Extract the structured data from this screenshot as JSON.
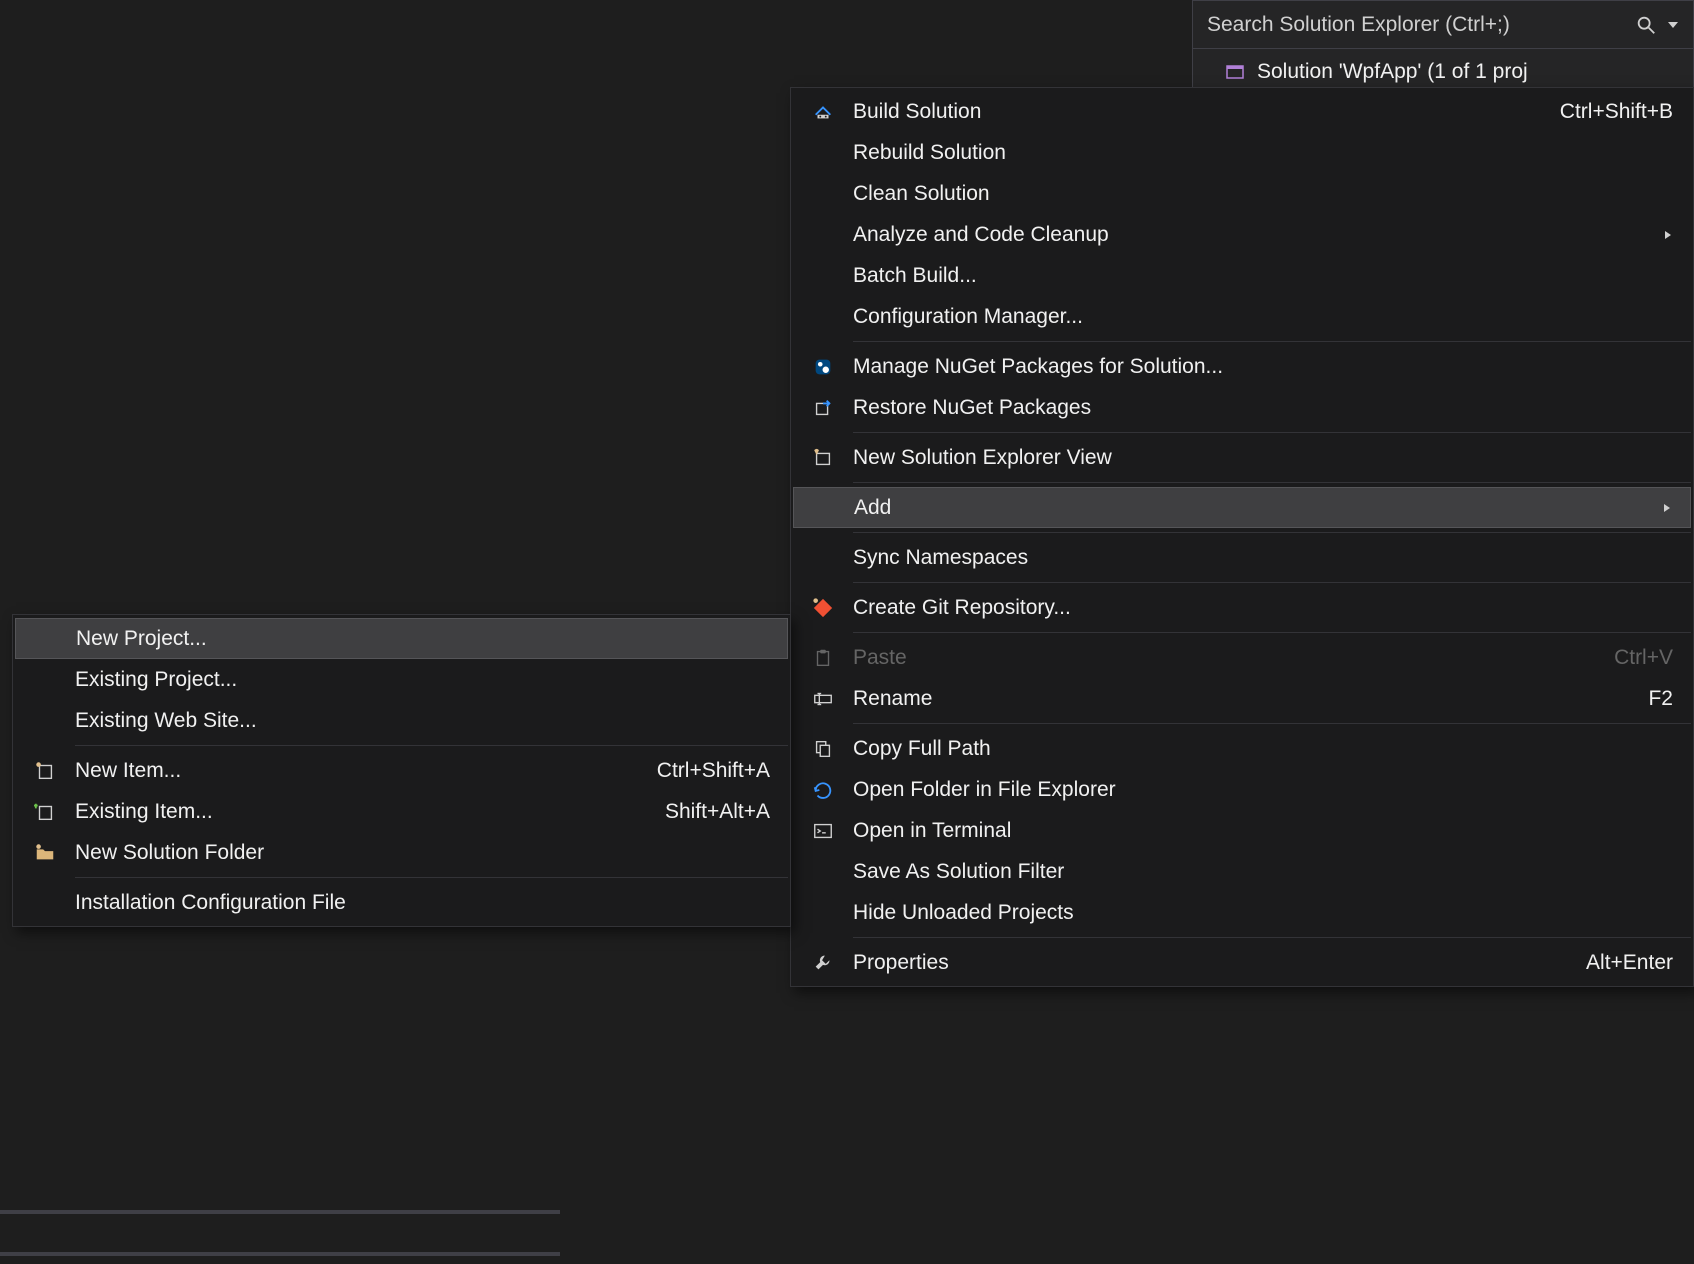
{
  "solutionExplorer": {
    "searchPlaceholder": "Search Solution Explorer (Ctrl+;)",
    "solutionLabel": "Solution 'WpfApp' (1 of 1 proj"
  },
  "mainMenu": {
    "items": [
      {
        "id": "build",
        "label": "Build Solution",
        "shortcut": "Ctrl+Shift+B",
        "icon": "build-icon"
      },
      {
        "id": "rebuild",
        "label": "Rebuild Solution"
      },
      {
        "id": "clean",
        "label": "Clean Solution"
      },
      {
        "id": "analyze",
        "label": "Analyze and Code Cleanup",
        "submenu": true
      },
      {
        "id": "batch",
        "label": "Batch Build..."
      },
      {
        "id": "cfg",
        "label": "Configuration Manager..."
      },
      {
        "sep": true
      },
      {
        "id": "nuget",
        "label": "Manage NuGet Packages for Solution...",
        "icon": "nuget-icon"
      },
      {
        "id": "restore",
        "label": "Restore NuGet Packages",
        "icon": "restore-icon"
      },
      {
        "sep": true
      },
      {
        "id": "newview",
        "label": "New Solution Explorer View",
        "icon": "newview-icon"
      },
      {
        "sep": true
      },
      {
        "id": "add",
        "label": "Add",
        "submenu": true,
        "highlight": true
      },
      {
        "sep": true
      },
      {
        "id": "sync",
        "label": "Sync Namespaces"
      },
      {
        "sep": true
      },
      {
        "id": "git",
        "label": "Create Git Repository...",
        "icon": "git-icon"
      },
      {
        "sep": true
      },
      {
        "id": "paste",
        "label": "Paste",
        "shortcut": "Ctrl+V",
        "icon": "paste-icon",
        "disabled": true
      },
      {
        "id": "rename",
        "label": "Rename",
        "shortcut": "F2",
        "icon": "rename-icon"
      },
      {
        "sep": true
      },
      {
        "id": "copypath",
        "label": "Copy Full Path",
        "icon": "copy-icon"
      },
      {
        "id": "openexp",
        "label": "Open Folder in File Explorer",
        "icon": "open-icon"
      },
      {
        "id": "terminal",
        "label": "Open in Terminal",
        "icon": "terminal-icon"
      },
      {
        "id": "savefilter",
        "label": "Save As Solution Filter"
      },
      {
        "id": "hideunload",
        "label": "Hide Unloaded Projects"
      },
      {
        "sep": true
      },
      {
        "id": "props",
        "label": "Properties",
        "shortcut": "Alt+Enter",
        "icon": "wrench-icon"
      }
    ]
  },
  "subMenu": {
    "items": [
      {
        "id": "newproj",
        "label": "New Project...",
        "highlight": true
      },
      {
        "id": "exproj",
        "label": "Existing Project..."
      },
      {
        "id": "exweb",
        "label": "Existing Web Site..."
      },
      {
        "sep": true
      },
      {
        "id": "newitem",
        "label": "New Item...",
        "shortcut": "Ctrl+Shift+A",
        "icon": "newitem-icon"
      },
      {
        "id": "exitem",
        "label": "Existing Item...",
        "shortcut": "Shift+Alt+A",
        "icon": "exitem-icon"
      },
      {
        "id": "newfolder",
        "label": "New Solution Folder",
        "icon": "folder-icon"
      },
      {
        "sep": true
      },
      {
        "id": "instcfg",
        "label": "Installation Configuration File"
      }
    ]
  }
}
